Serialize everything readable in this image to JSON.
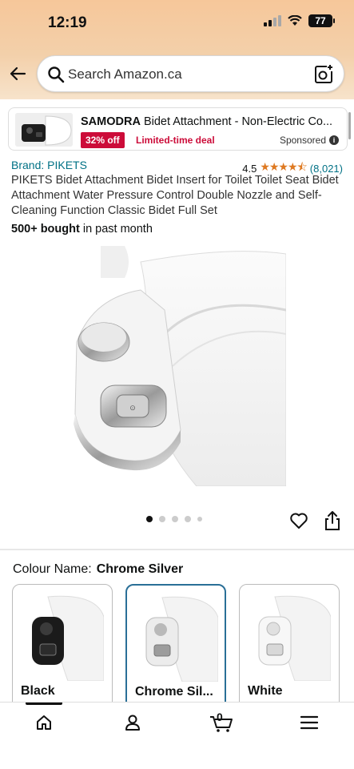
{
  "status": {
    "time": "12:19",
    "battery": "77"
  },
  "search": {
    "placeholder": "Search Amazon.ca"
  },
  "ad": {
    "brand": "SAMODRA",
    "title_rest": "Bidet Attachment - Non-Electric Co...",
    "badge": "32% off",
    "deal": "Limited-time deal",
    "sponsored": "Sponsored"
  },
  "product": {
    "brand": "Brand: PIKETS",
    "rating": "4.5",
    "rating_count": "(8,021)",
    "title": "PIKETS Bidet Attachment Bidet Insert for Toilet Toilet Seat Bidet Attachment Water Pressure Control Double Nozzle and Self-Cleaning Function Classic Bidet Full Set",
    "bought_bold": "500+ bought",
    "bought_rest": " in past month"
  },
  "colour": {
    "label": "Colour Name:",
    "selected": "Chrome Silver",
    "options": [
      {
        "name": "Black"
      },
      {
        "name": "Chrome Sil..."
      },
      {
        "name": "White"
      }
    ]
  },
  "nav": {
    "cart_count": "0"
  },
  "colors": {
    "link": "#007185",
    "deal_red": "#CC0C39",
    "star": "#DE7921",
    "selected_border": "#2a6f97"
  },
  "icons": [
    "back-arrow-icon",
    "search-icon",
    "camera-lens-icon",
    "info-icon",
    "heart-icon",
    "share-icon",
    "home-icon",
    "account-icon",
    "cart-icon",
    "menu-icon"
  ]
}
